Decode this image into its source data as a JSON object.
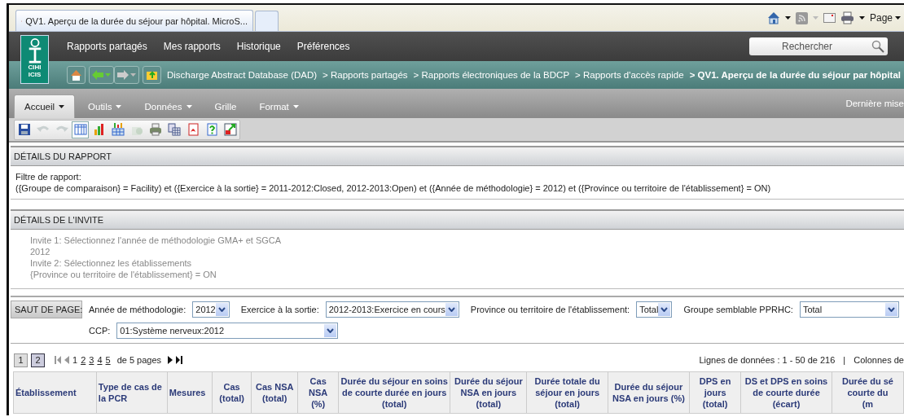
{
  "browser": {
    "tab_title": "QV1. Aperçu de la durée du séjour par hôpital. MicroS...",
    "page_menu": "Page"
  },
  "logo": {
    "top": "CIHI",
    "bottom": "ICIS"
  },
  "nav": [
    {
      "label": "Rapports partagés"
    },
    {
      "label": "Mes rapports"
    },
    {
      "label": "Historique"
    },
    {
      "label": "Préférences"
    }
  ],
  "search": {
    "placeholder": "Rechercher"
  },
  "breadcrumb": [
    {
      "label": "Discharge Abstract Database (DAD)",
      "current": false
    },
    {
      "label": "> Rapports partagés",
      "current": false
    },
    {
      "label": "> Rapports électroniques de la BDCP",
      "current": false
    },
    {
      "label": "> Rapports d'accès rapide",
      "current": false
    },
    {
      "label": "> QV1. Aperçu de la durée du séjour par hôpital",
      "current": true
    }
  ],
  "menu": [
    {
      "label": "Accueil",
      "selected": true,
      "dropdown": true
    },
    {
      "label": "Outils",
      "selected": false,
      "dropdown": true
    },
    {
      "label": "Données",
      "selected": false,
      "dropdown": true
    },
    {
      "label": "Grille",
      "selected": false,
      "dropdown": false
    },
    {
      "label": "Format",
      "selected": false,
      "dropdown": true
    }
  ],
  "menu_status": "Dernière mise",
  "toolbar": [
    {
      "kind": "save",
      "disabled": false,
      "selected": false
    },
    {
      "kind": "undo",
      "disabled": true,
      "selected": false
    },
    {
      "kind": "redo",
      "disabled": true,
      "selected": false
    },
    {
      "kind": "grid",
      "disabled": false,
      "selected": true
    },
    {
      "kind": "chart",
      "disabled": false,
      "selected": false
    },
    {
      "kind": "chart-grid",
      "disabled": false,
      "selected": false
    },
    {
      "kind": "export",
      "disabled": true,
      "selected": false
    },
    {
      "kind": "print",
      "disabled": false,
      "selected": false
    },
    {
      "kind": "copy",
      "disabled": false,
      "selected": false
    },
    {
      "kind": "pdf",
      "disabled": false,
      "selected": false
    },
    {
      "kind": "help",
      "disabled": false,
      "selected": false
    },
    {
      "kind": "swap",
      "disabled": false,
      "selected": false
    }
  ],
  "report_details": {
    "title": "DÉTAILS DU RAPPORT",
    "label": "Filtre de rapport:",
    "filter": "({Groupe de comparaison} = Facility) et ({Exercice à la sortie} = 2011-2012:Closed, 2012-2013:Open) et ({Année de méthodologie} = 2012) et ({Province ou territoire de l'établissement} = ON)"
  },
  "prompt_details": {
    "title": "DÉTAILS DE L'INVITE",
    "lines": [
      "Invite 1: Sélectionnez l'année de méthodologie GMA+ et SGCA",
      "2012",
      "Invite 2: Sélectionnez les établissements",
      "{Province ou territoire de l'établissement} = ON"
    ]
  },
  "page_break": {
    "button": "SAUT DE PAGE:",
    "field_rows": [
      [
        {
          "label": "Année de méthodologie:",
          "value": "2012"
        },
        {
          "label": "Exercice à la sortie:",
          "value": "2012-2013:Exercice en cours"
        },
        {
          "label": "Province ou territoire de l'établissement:",
          "value": "Total"
        },
        {
          "label": "Groupe semblable PPRHC:",
          "value": "Total"
        }
      ],
      [
        {
          "label": "CCP:",
          "value": "01:Système nerveux:2012"
        }
      ]
    ]
  },
  "pagination": {
    "views": [
      {
        "label": "1",
        "selected": false
      },
      {
        "label": "2",
        "selected": true
      }
    ],
    "pages": [
      {
        "label": "1",
        "selected": true
      },
      {
        "label": "2",
        "selected": false
      },
      {
        "label": "3",
        "selected": false
      },
      {
        "label": "4",
        "selected": false
      },
      {
        "label": "5",
        "selected": false
      }
    ],
    "total": "de 5 pages",
    "rows_info": "Lignes de données : 1 - 50 de 216",
    "separator": "|",
    "columns_info": "Colonnes de"
  },
  "table": {
    "columns": [
      "Établissement",
      "Type de cas de\nla PCR",
      "Mesures",
      "Cas\n(total)",
      "Cas NSA\n(total)",
      "Cas NSA\n(%)",
      "Durée du séjour en soins\nde courte durée en jours\n(total)",
      "Durée du séjour\nNSA en jours\n(total)",
      "Durée totale du\nséjour en jours\n(total)",
      "Durée du séjour\nNSA en jours (%)",
      "DPS en\njours\n(total)",
      "DS et DPS en soins\nde courte durée\n(écart)",
      "Durée du sé\ncourte du\n(m"
    ]
  }
}
